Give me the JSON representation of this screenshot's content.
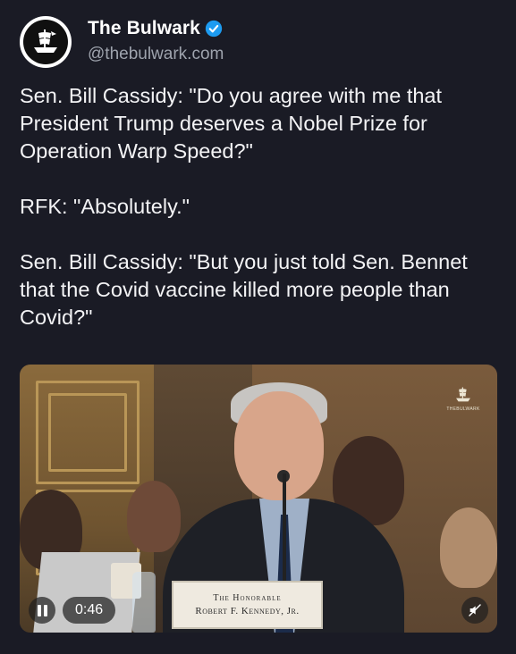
{
  "account": {
    "display_name": "The Bulwark",
    "handle": "@thebulwark.com",
    "verified": true,
    "avatar_icon": "pirate-ship-logo-icon"
  },
  "tweet": {
    "text": "Sen. Bill Cassidy: \"Do you agree with me that President Trump deserves a Nobel Prize for Operation Warp Speed?\"\n\nRFK: \"Absolutely.\"\n\nSen. Bill Cassidy: \"But you just told Sen. Bennet that the Covid vaccine killed more people than Covid?\""
  },
  "video": {
    "nameplate_line1": "The Honorable",
    "nameplate_line2": "Robert F. Kennedy, Jr.",
    "watermark_text": "THEBULWARK",
    "elapsed": "0:46",
    "state": "playing",
    "muted": true
  },
  "colors": {
    "background": "#1a1b25",
    "text": "#f3f3f5",
    "handle": "#9ea3ad",
    "verified_badge": "#1d9bf0"
  }
}
